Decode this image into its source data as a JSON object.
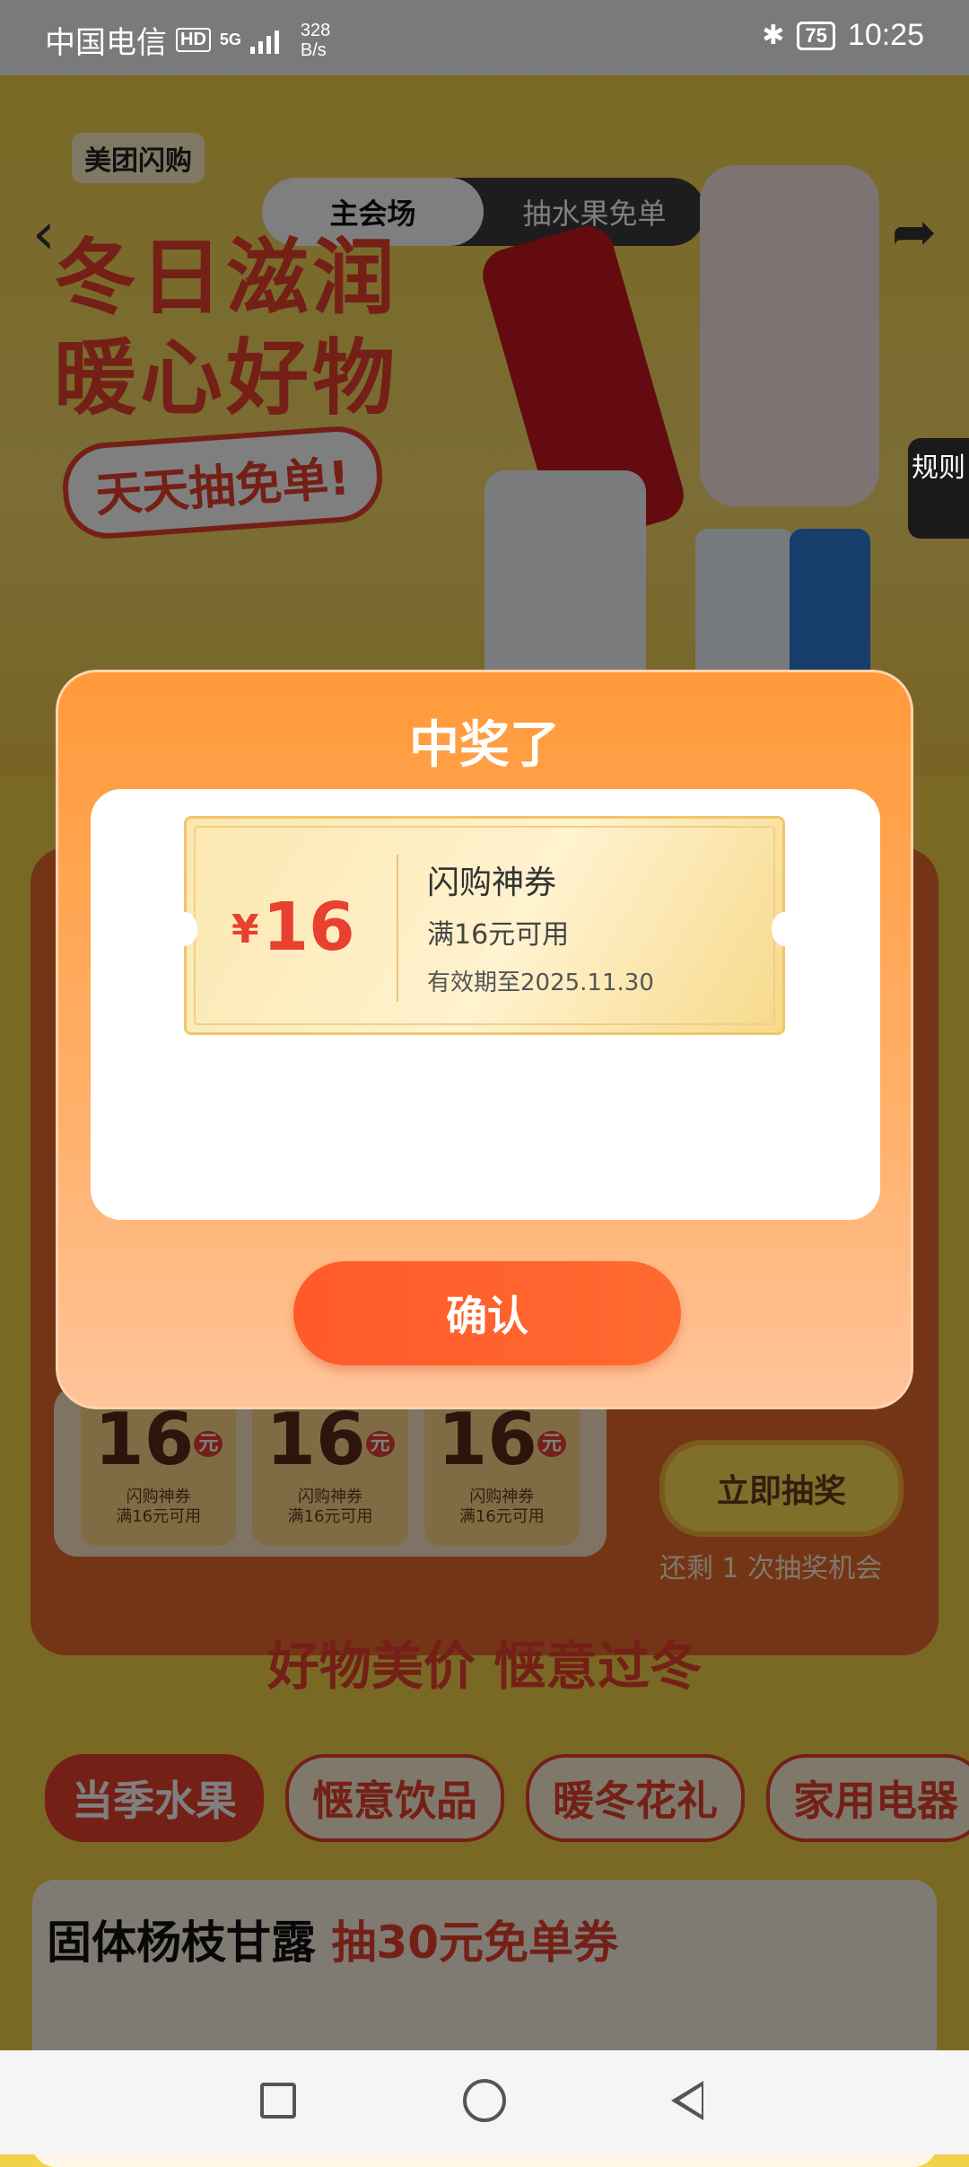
{
  "status_bar": {
    "carrier": "中国电信",
    "hd": "HD",
    "network": "5G",
    "speed_value": "328",
    "speed_unit": "B/s",
    "battery": "75",
    "time": "10:25"
  },
  "header": {
    "brand": "美团闪购",
    "tabs": [
      {
        "label": "主会场",
        "active": true
      },
      {
        "label": "抽水果免单",
        "active": false
      }
    ]
  },
  "hero": {
    "title_line1": "冬日滋润",
    "title_line2": "暖心好物",
    "subtitle": "天天抽免单!"
  },
  "side": {
    "rules": "规则"
  },
  "draw_panel": {
    "coupons": [
      {
        "amount": "16",
        "unit": "元",
        "name": "闪购神券",
        "cond": "满16元可用"
      },
      {
        "amount": "16",
        "unit": "元",
        "name": "闪购神券",
        "cond": "满16元可用"
      },
      {
        "amount": "16",
        "unit": "元",
        "name": "闪购神券",
        "cond": "满16元可用"
      }
    ],
    "draw_button": "立即抽奖",
    "remaining": "还剩 1 次抽奖机会"
  },
  "section": {
    "title": "好物美价 惬意过冬",
    "categories": [
      {
        "label": "当季水果",
        "active": true
      },
      {
        "label": "惬意饮品",
        "active": false
      },
      {
        "label": "暖冬花礼",
        "active": false
      },
      {
        "label": "家用电器",
        "active": false
      }
    ],
    "card_title": "固体杨枝甘露",
    "card_promo": "抽30元免单券"
  },
  "modal": {
    "title": "中奖了",
    "coupon": {
      "currency": "¥",
      "amount": "16",
      "name": "闪购神券",
      "condition": "满16元可用",
      "expiry": "有效期至2025.11.30"
    },
    "confirm": "确认"
  },
  "colors": {
    "accent_red": "#e8412f",
    "modal_orange": "#ff9a3a",
    "confirm_orange": "#ff5a2a"
  }
}
